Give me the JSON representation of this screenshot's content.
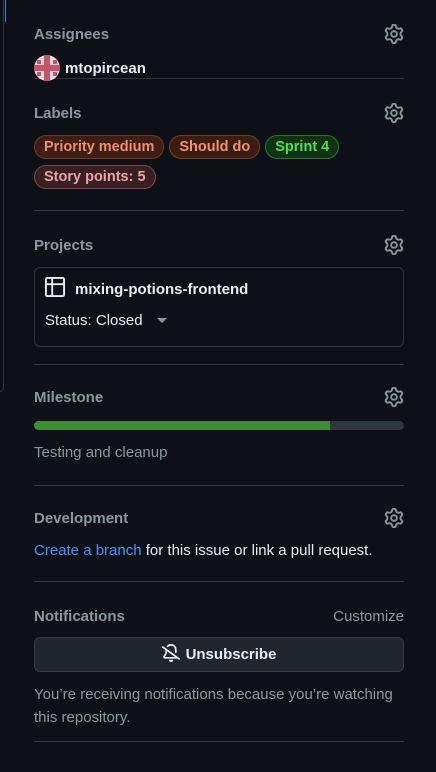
{
  "assignees": {
    "title": "Assignees",
    "user": "mtopircean"
  },
  "labels": {
    "title": "Labels",
    "items": [
      {
        "text": "Priority medium",
        "color": "#f08e6e"
      },
      {
        "text": "Should do",
        "color": "#f0946c"
      },
      {
        "text": "Sprint 4",
        "color": "#4ee04e"
      },
      {
        "text": "Story points: 5",
        "color": "#e8a5a5"
      }
    ]
  },
  "projects": {
    "title": "Projects",
    "name": "mixing-potions-frontend",
    "status": "Status: Closed"
  },
  "milestone": {
    "title": "Milestone",
    "name": "Testing and cleanup",
    "progress_fraction": 0.8,
    "progress_color": "#3e8d36"
  },
  "development": {
    "title": "Development",
    "link_text": "Create a branch",
    "rest_text": " for this issue or link a pull request."
  },
  "notifications": {
    "title": "Notifications",
    "customize": "Customize",
    "button": "Unsubscribe",
    "text": "You’re receiving notifications because you’re watching this repository."
  },
  "icons": {
    "gear": "gear-icon",
    "table": "table-icon",
    "bell_slash": "bell-slash-icon"
  }
}
